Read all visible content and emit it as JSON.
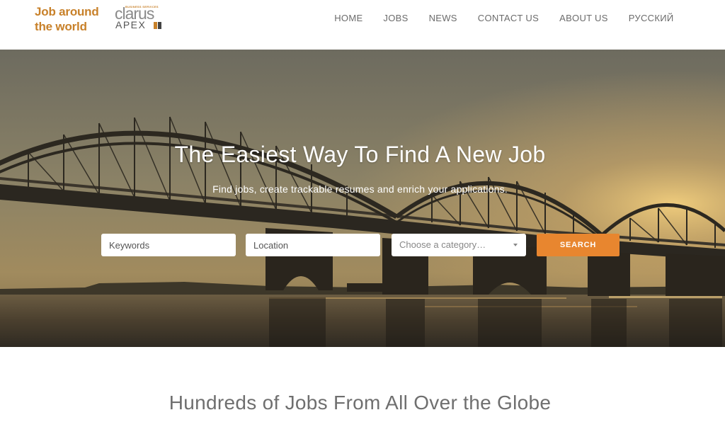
{
  "brand": {
    "line1": "Job around",
    "line2": "the world",
    "color": "#c8812a"
  },
  "partner_logo": {
    "tagline": "BUSINESS SERVICES",
    "word1": "clarus",
    "word2": "APEX",
    "colors": [
      "#c8812a",
      "#444444"
    ]
  },
  "nav": {
    "items": [
      {
        "label": "HOME"
      },
      {
        "label": "JOBS"
      },
      {
        "label": "NEWS"
      },
      {
        "label": "CONTACT US"
      },
      {
        "label": "ABOUT US"
      },
      {
        "label": "РУССКИЙ"
      }
    ]
  },
  "hero": {
    "title": "The Easiest Way To Find A New Job",
    "subtitle": "Find jobs, create trackable resumes and enrich your applications.",
    "search": {
      "keywords_placeholder": "Keywords",
      "location_placeholder": "Location",
      "category_selected": "Choose a category…",
      "button_label": "SEARCH"
    },
    "accent_color": "#e8862f"
  },
  "section": {
    "title": "Hundreds of Jobs From All Over the Globe"
  }
}
